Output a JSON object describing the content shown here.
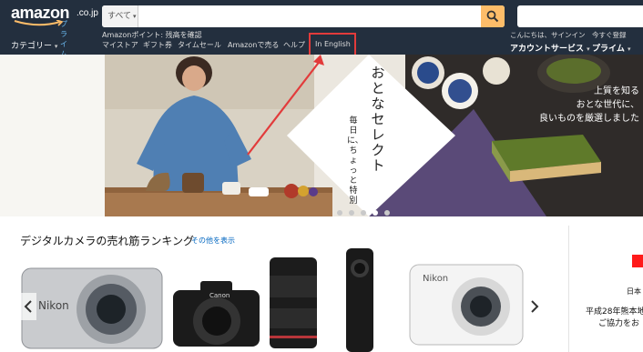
{
  "header": {
    "logo_text": "amazon",
    "logo_suffix": ".co.jp",
    "logo_prime": "プライム",
    "search_category": "すべて",
    "points_text": "Amazonポイント: 残高を確認",
    "nav_links": [
      "マイストア",
      "ギフト券",
      "タイムセール",
      "Amazonで売る",
      "ヘルプ",
      "In English"
    ],
    "category_label": "カテゴリー",
    "account_line1": "こんにちは、サインイン",
    "account_line2": "アカウントサービス",
    "prime_line1": "今すぐ登録",
    "prime_line2": "プライム",
    "highlight_color": "#e23b3b"
  },
  "hero": {
    "title": "おとなセレクト",
    "subtitle": "毎日に、ちょっと特別",
    "right_lines": [
      "上質を知る",
      "おとな世代に、",
      "良いものを厳選しました"
    ],
    "slide_count": 5,
    "active_slide": 3
  },
  "ranking": {
    "title": "デジタルカメラの売れ筋ランキング",
    "see_more": "その他を表示"
  },
  "side_panel": {
    "line1": "日本",
    "line2": "平成28年熊本地",
    "line3": "ご協力をお"
  },
  "colors": {
    "header_bg": "#232f3e",
    "search_button": "#febd69",
    "link": "#0066c0",
    "accent_red": "#e23b3b"
  }
}
